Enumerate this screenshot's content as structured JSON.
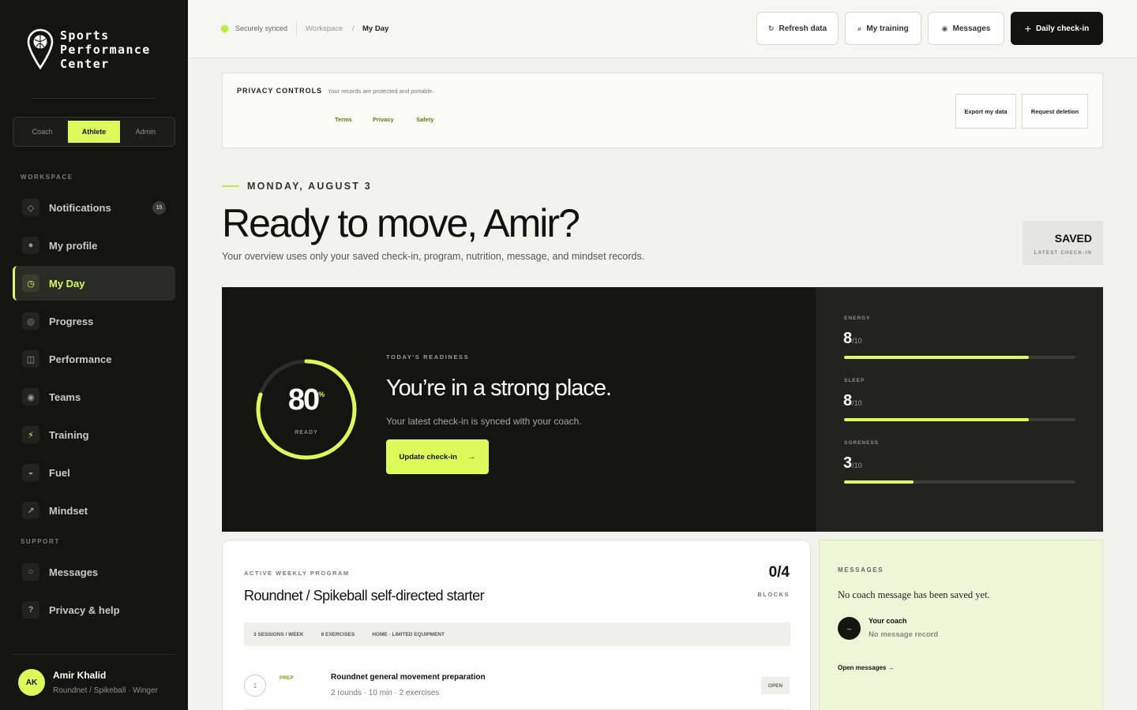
{
  "brand": {
    "name_line1": "Sports",
    "name_line2": "Performance",
    "name_line3": "Center"
  },
  "roles": [
    "Coach",
    "Athlete",
    "Admin"
  ],
  "active_role": "Athlete",
  "sidebar": {
    "workspace_label": "WORKSPACE",
    "support_label": "SUPPORT",
    "items": [
      {
        "label": "Notifications",
        "icon": "diamond-icon",
        "badge": "15"
      },
      {
        "label": "My profile",
        "icon": "dot-icon"
      },
      {
        "label": "My Day",
        "icon": "clock-icon",
        "active": true
      },
      {
        "label": "Progress",
        "icon": "target-icon"
      },
      {
        "label": "Performance",
        "icon": "columns-icon"
      },
      {
        "label": "Teams",
        "icon": "circle-icon"
      },
      {
        "label": "Training",
        "icon": "bolt-icon"
      },
      {
        "label": "Fuel",
        "icon": "half-circle-icon"
      },
      {
        "label": "Mindset",
        "icon": "arrow-up-right-icon"
      }
    ],
    "support_items": [
      {
        "label": "Messages",
        "icon": "bubble-icon"
      },
      {
        "label": "Privacy & help",
        "icon": "question-icon"
      }
    ]
  },
  "user": {
    "initials": "AK",
    "name": "Amir Khalid",
    "subtitle": "Roundnet / Spikeball · Winger"
  },
  "header": {
    "sync": "Securely synced",
    "crumb_workspace": "Workspace",
    "crumb_sep": "/",
    "crumb_current": "My Day",
    "buttons": {
      "refresh": "Refresh data",
      "training": "My training",
      "messages": "Messages",
      "checkin": "Daily check-in"
    }
  },
  "privacy": {
    "title": "PRIVACY CONTROLS",
    "subtitle": "Your records are protected and portable.",
    "links": [
      "Terms",
      "Privacy",
      "Safety"
    ],
    "export": "Export my data",
    "deletion": "Request deletion"
  },
  "hero": {
    "date": "MONDAY, AUGUST 3",
    "title": "Ready to move, Amir?",
    "subtitle": "Your overview uses only your saved check-in, program, nutrition, message, and mindset records.",
    "saved": "SAVED",
    "saved_sub": "LATEST CHECK-IN"
  },
  "readiness": {
    "value": "80",
    "unit": "%",
    "percent": 80,
    "label": "READY",
    "eyebrow": "TODAY'S READINESS",
    "title": "You’re in a strong place.",
    "subtitle": "Your latest check-in is synced with your coach.",
    "button": "Update check-in",
    "button_arrow": "→",
    "colors": {
      "accent": "#dcfa5a",
      "dark": "#141511"
    }
  },
  "metrics": [
    {
      "label": "ENERGY",
      "value": "8",
      "max": "/10",
      "fraction": 0.8
    },
    {
      "label": "SLEEP",
      "value": "8",
      "max": "/10",
      "fraction": 0.8
    },
    {
      "label": "SORENESS",
      "value": "3",
      "max": "/10",
      "fraction": 0.3
    }
  ],
  "program": {
    "eyebrow": "ACTIVE WEEKLY PROGRAM",
    "title": "Roundnet / Spikeball self-directed starter",
    "count": "0/4",
    "count_label": "BLOCKS",
    "tags": [
      "3 SESSIONS / WEEK",
      "8 EXERCISES",
      "HOME · LIMITED EQUIPMENT"
    ],
    "block": {
      "number": "1",
      "tag": "PREP",
      "title": "Roundnet general movement preparation",
      "subtitle": "2 rounds · 10 min · 2 exercises",
      "action": "OPEN"
    }
  },
  "messages": {
    "eyebrow": "MESSAGES",
    "text": "No coach message has been saved yet.",
    "avatar": "–",
    "coach": "Your coach",
    "none": "No message record",
    "open": "Open messages →"
  }
}
